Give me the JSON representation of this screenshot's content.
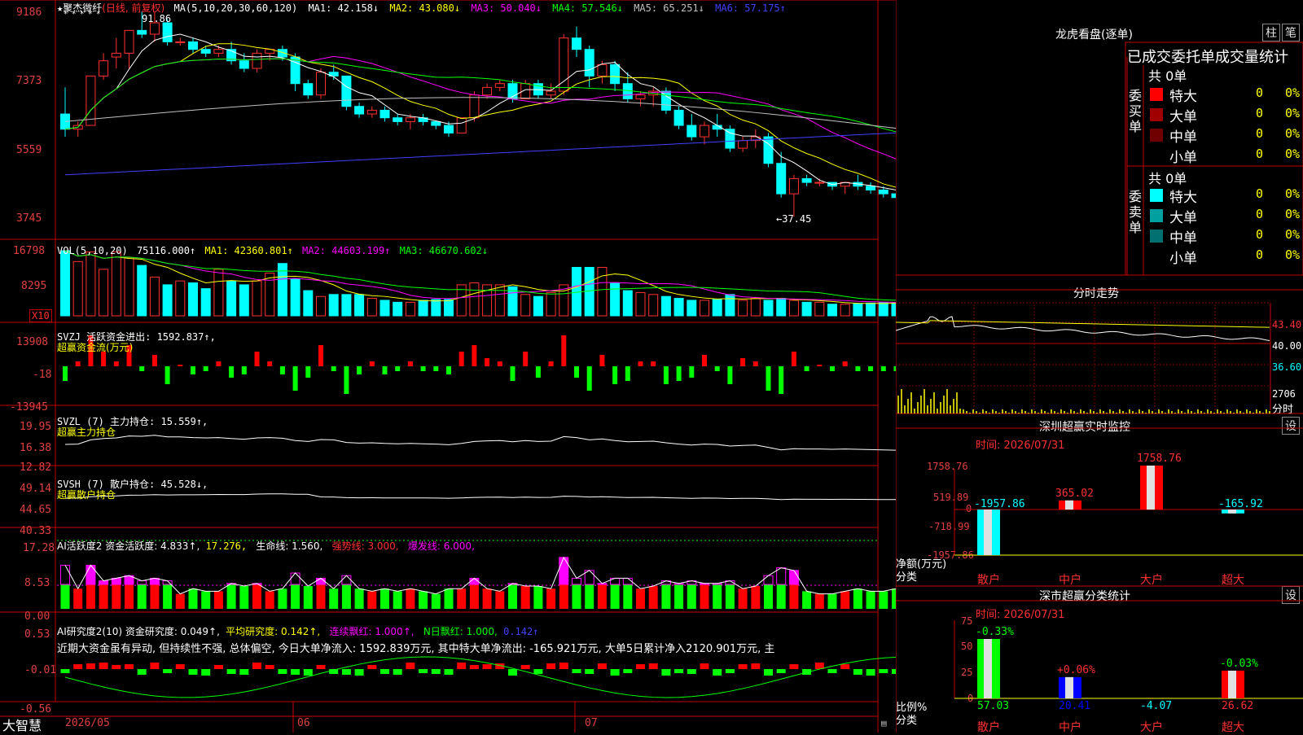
{
  "stock": {
    "name": "聚杰微纤",
    "period_label": "(日线, 前复权)"
  },
  "main_legend": {
    "ma_label": "MA(5,10,20,30,60,120)",
    "items": [
      {
        "text": "MA1: 42.158↓",
        "color": "#ffffff"
      },
      {
        "text": "MA2: 43.080↓",
        "color": "#ffff00"
      },
      {
        "text": "MA3: 50.040↓",
        "color": "#ff00ff"
      },
      {
        "text": "MA4: 57.546↓",
        "color": "#00ff00"
      },
      {
        "text": "MA5: 65.251↓",
        "color": "#c0c0c0"
      },
      {
        "text": "MA6: 57.175↑",
        "color": "#4040ff"
      }
    ],
    "high_mark": "91.86",
    "low_mark": "←37.45"
  },
  "main_axis": [
    "9186",
    "7373",
    "5559",
    "3745"
  ],
  "vol": {
    "label": "VOL(5,10,20)",
    "val": "75116.000↑",
    "ma1": "MA1: 42360.801↑",
    "ma2": "MA2: 44603.199↑",
    "ma3": "MA3: 46670.602↓",
    "axis": [
      "16798",
      "8295"
    ],
    "unit": "X10"
  },
  "svzj": {
    "title": "SVZJ  活跃资金进出: 1592.837↑,",
    "subtitle": "超赢资金流(万元)",
    "axis": [
      "13908",
      "-18",
      "-13945"
    ]
  },
  "svzl": {
    "title": "SVZL (7) 主力持仓: 15.559↑,",
    "subtitle": "超赢主力持仓",
    "axis": [
      "19.95",
      "16.38",
      "12.82"
    ]
  },
  "svsh": {
    "title": "SVSH (7) 散户持仓: 45.528↓,",
    "subtitle": "超赢散户持仓",
    "axis": [
      "49.14",
      "44.65",
      "40.33"
    ]
  },
  "ai_active": {
    "label": "AI活跃度2 资金活跃度: 4.833↑,",
    "v2": "17.276,",
    "v3": "生命线: 1.560,",
    "v4": "强势线: 3.000,",
    "v5": "爆发线: 6.000,",
    "axis": [
      "17.28",
      "8.53",
      "0.00"
    ]
  },
  "ai_research": {
    "label": "AI研究度2(10) 资金研究度: 0.049↑,",
    "v2": "平均研究度: 0.142↑,",
    "v3": "连续飘红: 1.000↑,",
    "v4": "N日飘红: 1.000,",
    "v5": "0.142↑",
    "summary": "近期大资金虽有异动, 但持续性不强, 总体偏空, 今日大单净流入: 1592.839万元, 其中特大单净流出: -165.921万元, 大单5日累计净入2120.901万元, 主",
    "axis": [
      "0.53",
      "-0.01",
      "-0.56"
    ]
  },
  "bottom": {
    "brand": "大智慧",
    "dates": [
      "2026/05",
      "06",
      "07"
    ]
  },
  "dragon": {
    "title": "龙虎看盘(逐单)",
    "btn1": "柱",
    "btn2": "笔",
    "header": "已成交委托单成交量统计",
    "buy_label": "委买单",
    "sell_label": "委卖单",
    "buy_total": "共 0单",
    "sell_total": "共 0单",
    "buy_rows": [
      {
        "name": "特大",
        "v": "0",
        "p": "0%",
        "c": "#ff0000"
      },
      {
        "name": "大单",
        "v": "0",
        "p": "0%",
        "c": "#a00000"
      },
      {
        "name": "中单",
        "v": "0",
        "p": "0%",
        "c": "#700000"
      },
      {
        "name": "小单",
        "v": "0",
        "p": "0%",
        "c": ""
      }
    ],
    "sell_rows": [
      {
        "name": "特大",
        "v": "0",
        "p": "0%",
        "c": "#00ffff"
      },
      {
        "name": "大单",
        "v": "0",
        "p": "0%",
        "c": "#00a0a0"
      },
      {
        "name": "中单",
        "v": "0",
        "p": "0%",
        "c": "#007070"
      },
      {
        "name": "小单",
        "v": "0",
        "p": "0%",
        "c": ""
      }
    ]
  },
  "intraday": {
    "title": "分时走势",
    "axis": [
      "43.40",
      "40.00",
      "36.60"
    ],
    "vol_label": "2706",
    "vol_unit": "分时"
  },
  "sz_monitor": {
    "title": "深圳超赢实时监控",
    "btn": "设",
    "date": "时间: 2026/07/31",
    "axis": [
      "1758.76",
      "519.89",
      "0",
      "-718.99",
      "-1957.86"
    ],
    "y_label": "净额(万元)",
    "x_label": "分类",
    "bars": [
      {
        "name": "散户",
        "value": -1957.86,
        "label": "-1957.86",
        "color": "#00ffff"
      },
      {
        "name": "中户",
        "value": 365.02,
        "label": "365.02",
        "color": "#ff0000"
      },
      {
        "name": "大户",
        "value": 1758.76,
        "label": "1758.76",
        "color": "#ff0000"
      },
      {
        "name": "超大",
        "value": -165.92,
        "label": "-165.92",
        "color": "#00ffff"
      }
    ],
    "ylim": [
      -1957.86,
      1758.76
    ]
  },
  "sz_class": {
    "title": "深市超赢分类统计",
    "btn": "设",
    "date": "时间: 2026/07/31",
    "axis": [
      "75",
      "50",
      "25",
      "0"
    ],
    "y_label": "比例%",
    "x_label": "分类",
    "bars": [
      {
        "name": "散户",
        "value": 57.03,
        "change": "-0.33%",
        "label": "57.03",
        "color": "#00ff00"
      },
      {
        "name": "中户",
        "value": 20.41,
        "change": "+0.06%",
        "label": "20.41",
        "color": "#0000ff"
      },
      {
        "name": "大户",
        "value": -4.07,
        "change": "",
        "label": "-4.07",
        "color": "#00ff00"
      },
      {
        "name": "超大",
        "value": 26.62,
        "change": "-0.03%",
        "label": "26.62",
        "color": "#ff0000"
      }
    ],
    "ylim": [
      0,
      75
    ]
  },
  "colors": {
    "up": "#ff3030",
    "down": "#00ffff",
    "border": "#c00000",
    "axis_text": "#e04040"
  },
  "chart_data": [
    {
      "type": "candlestick",
      "title": "聚杰微纤 (日线, 前复权)",
      "ylim": [
        37.45,
        91.86
      ],
      "ohlc": [
        [
          64,
          71,
          58,
          60
        ],
        [
          60,
          62,
          58,
          61
        ],
        [
          61,
          74,
          61,
          74
        ],
        [
          74,
          80,
          73,
          78
        ],
        [
          79,
          84,
          76,
          80
        ],
        [
          80,
          85,
          76,
          86
        ],
        [
          86,
          91,
          84,
          85
        ],
        [
          85,
          91,
          83,
          88
        ],
        [
          88,
          89,
          82,
          83
        ],
        [
          83,
          84,
          82,
          83
        ],
        [
          83,
          84,
          80,
          81
        ],
        [
          81,
          82,
          79,
          80
        ],
        [
          80,
          82,
          79,
          81
        ],
        [
          81,
          83,
          77,
          78
        ],
        [
          78,
          80,
          75,
          76
        ],
        [
          76,
          81,
          75,
          80
        ],
        [
          80,
          81,
          78,
          81
        ],
        [
          81,
          82,
          78,
          79
        ],
        [
          79,
          80,
          70,
          72
        ],
        [
          72,
          73,
          68,
          69
        ],
        [
          69,
          76,
          68,
          75
        ],
        [
          75,
          77,
          73,
          74
        ],
        [
          74,
          74,
          65,
          66
        ],
        [
          66,
          67,
          63,
          64
        ],
        [
          64,
          66,
          63,
          65
        ],
        [
          65,
          66,
          62,
          63
        ],
        [
          63,
          64,
          61,
          62
        ],
        [
          62,
          64,
          60,
          63
        ],
        [
          63,
          64,
          61,
          62
        ],
        [
          62,
          62,
          60,
          61
        ],
        [
          61,
          62,
          58,
          59
        ],
        [
          59,
          63,
          59,
          63
        ],
        [
          63,
          70,
          62,
          69
        ],
        [
          69,
          72,
          68,
          71
        ],
        [
          71,
          73,
          70,
          72
        ],
        [
          72,
          73,
          67,
          68
        ],
        [
          68,
          73,
          68,
          72
        ],
        [
          72,
          73,
          68,
          69
        ],
        [
          69,
          72,
          68,
          70
        ],
        [
          70,
          85,
          69,
          84
        ],
        [
          84,
          87,
          79,
          81
        ],
        [
          81,
          82,
          71,
          74
        ],
        [
          74,
          78,
          72,
          77
        ],
        [
          77,
          78,
          70,
          72
        ],
        [
          72,
          75,
          67,
          68
        ],
        [
          68,
          70,
          66,
          69
        ],
        [
          69,
          71,
          66,
          70
        ],
        [
          70,
          71,
          64,
          65
        ],
        [
          65,
          66,
          60,
          61
        ],
        [
          61,
          64,
          57,
          58
        ],
        [
          58,
          62,
          56,
          61
        ],
        [
          61,
          64,
          58,
          60
        ],
        [
          60,
          61,
          54,
          55
        ],
        [
          55,
          58,
          54,
          57
        ],
        [
          57,
          60,
          55,
          58
        ],
        [
          58,
          59,
          50,
          51
        ],
        [
          51,
          54,
          42,
          43
        ],
        [
          43,
          48,
          37,
          47
        ],
        [
          47,
          48,
          45,
          46
        ],
        [
          46,
          47,
          45,
          46
        ],
        [
          46,
          46,
          44,
          45
        ],
        [
          45,
          46,
          43,
          46
        ],
        [
          46,
          48,
          44,
          45
        ],
        [
          45,
          46,
          43,
          44
        ],
        [
          44,
          45,
          42,
          43
        ],
        [
          43,
          44,
          40,
          42
        ],
        [
          42,
          50,
          41,
          43
        ]
      ],
      "volume": [
        16798,
        14000,
        16500,
        12000,
        16500,
        15000,
        13000,
        10000,
        8000,
        9000,
        8500,
        7000,
        12000,
        9000,
        8000,
        9000,
        11000,
        13500,
        9500,
        6500,
        5000,
        5500,
        5500,
        5500,
        4500,
        4000,
        3500,
        3500,
        4000,
        4200,
        4200,
        8000,
        8500,
        8000,
        8000,
        7500,
        5500,
        5000,
        6000,
        8000,
        12500,
        12500,
        12500,
        8500,
        6500,
        6000,
        5500,
        5000,
        4500,
        4000,
        4000,
        4200,
        5500,
        4000,
        4500,
        4000,
        4500,
        4000,
        3500,
        3500,
        3000,
        3000,
        3200,
        3300,
        3400,
        3400,
        7000
      ]
    },
    {
      "type": "bar",
      "title": "深圳超赢实时监控",
      "categories": [
        "散户",
        "中户",
        "大户",
        "超大"
      ],
      "values": [
        -1957.86,
        365.02,
        1758.76,
        -165.92
      ],
      "ylabel": "净额(万元)",
      "ylim": [
        -1957.86,
        1758.76
      ]
    },
    {
      "type": "bar",
      "title": "深市超赢分类统计",
      "categories": [
        "散户",
        "中户",
        "大户",
        "超大"
      ],
      "values": [
        57.03,
        20.41,
        -4.07,
        26.62
      ],
      "ylabel": "比例%",
      "ylim": [
        0,
        75
      ]
    }
  ]
}
